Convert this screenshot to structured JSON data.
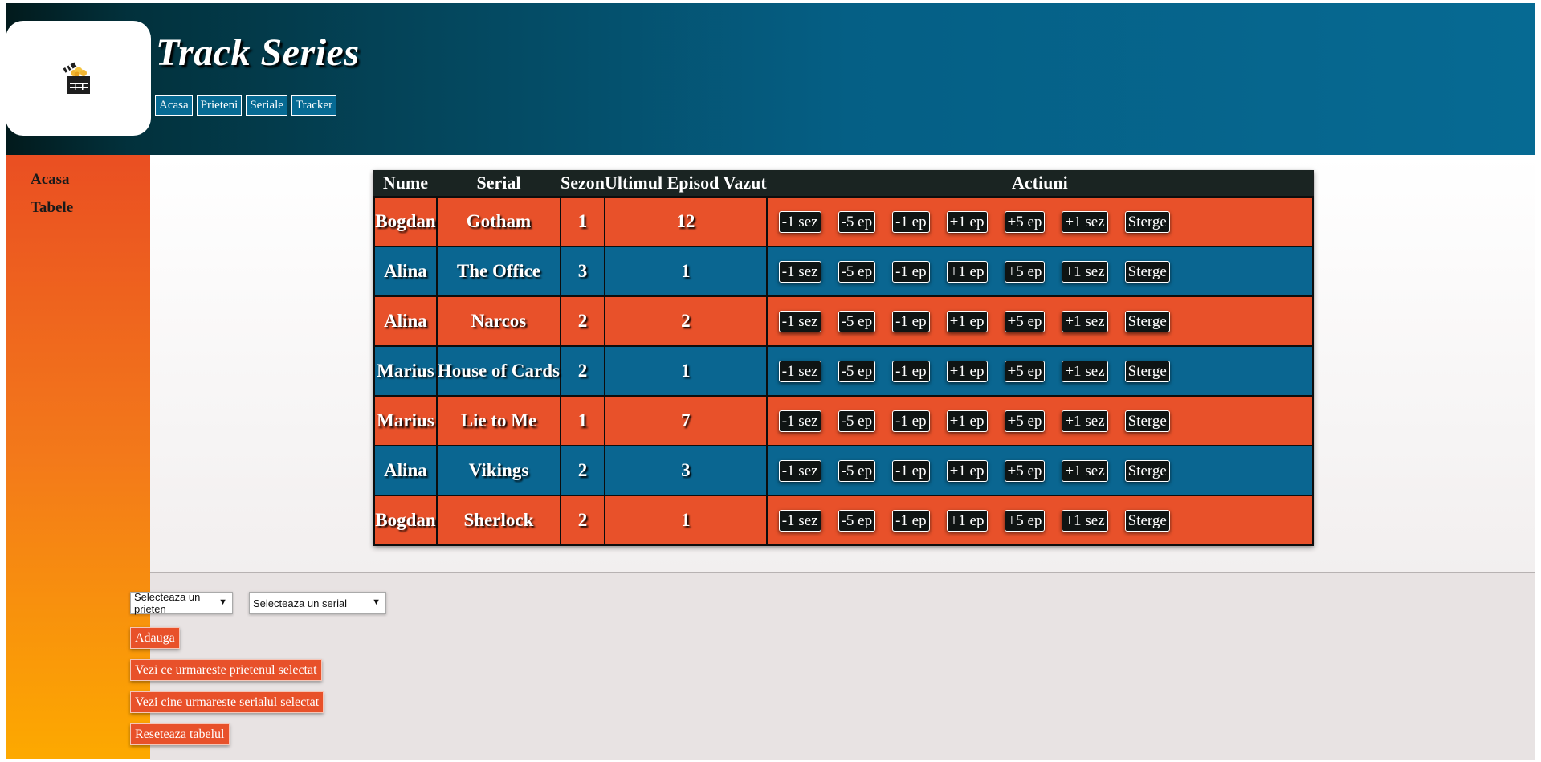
{
  "header": {
    "title": "Track Series",
    "logo_icon": "clapperboard-popcorn-icon",
    "nav": [
      "Acasa",
      "Prieteni",
      "Seriale",
      "Tracker"
    ]
  },
  "sidebar": {
    "items": [
      "Acasa",
      "Tabele"
    ]
  },
  "table": {
    "columns": [
      "Nume",
      "Serial",
      "Sezon",
      "Ultimul Episod Vazut",
      "Actiuni"
    ],
    "action_labels": [
      "-1 sez",
      "-5 ep",
      "-1 ep",
      "+1 ep",
      "+5 ep",
      "+1 sez",
      "Sterge"
    ],
    "rows": [
      {
        "name": "Bogdan",
        "serial": "Gotham",
        "season": "1",
        "episode": "12"
      },
      {
        "name": "Alina",
        "serial": "The Office",
        "season": "3",
        "episode": "1"
      },
      {
        "name": "Alina",
        "serial": "Narcos",
        "season": "2",
        "episode": "2"
      },
      {
        "name": "Marius",
        "serial": "House of Cards",
        "season": "2",
        "episode": "1"
      },
      {
        "name": "Marius",
        "serial": "Lie to Me",
        "season": "1",
        "episode": "7"
      },
      {
        "name": "Alina",
        "serial": "Vikings",
        "season": "2",
        "episode": "3"
      },
      {
        "name": "Bogdan",
        "serial": "Sherlock",
        "season": "2",
        "episode": "1"
      }
    ]
  },
  "controls": {
    "friend_select": "Selecteaza un prieten",
    "series_select": "Selecteaza un serial",
    "add_button": "Adauga",
    "view_friend_button": "Vezi ce urmareste prietenul selectat",
    "view_series_button": "Vezi cine urmareste serialul selectat",
    "reset_button": "Reseteaza tabelul"
  },
  "colors": {
    "orange": "#e8512a",
    "blue": "#0a6691",
    "dark": "#0f1413"
  }
}
